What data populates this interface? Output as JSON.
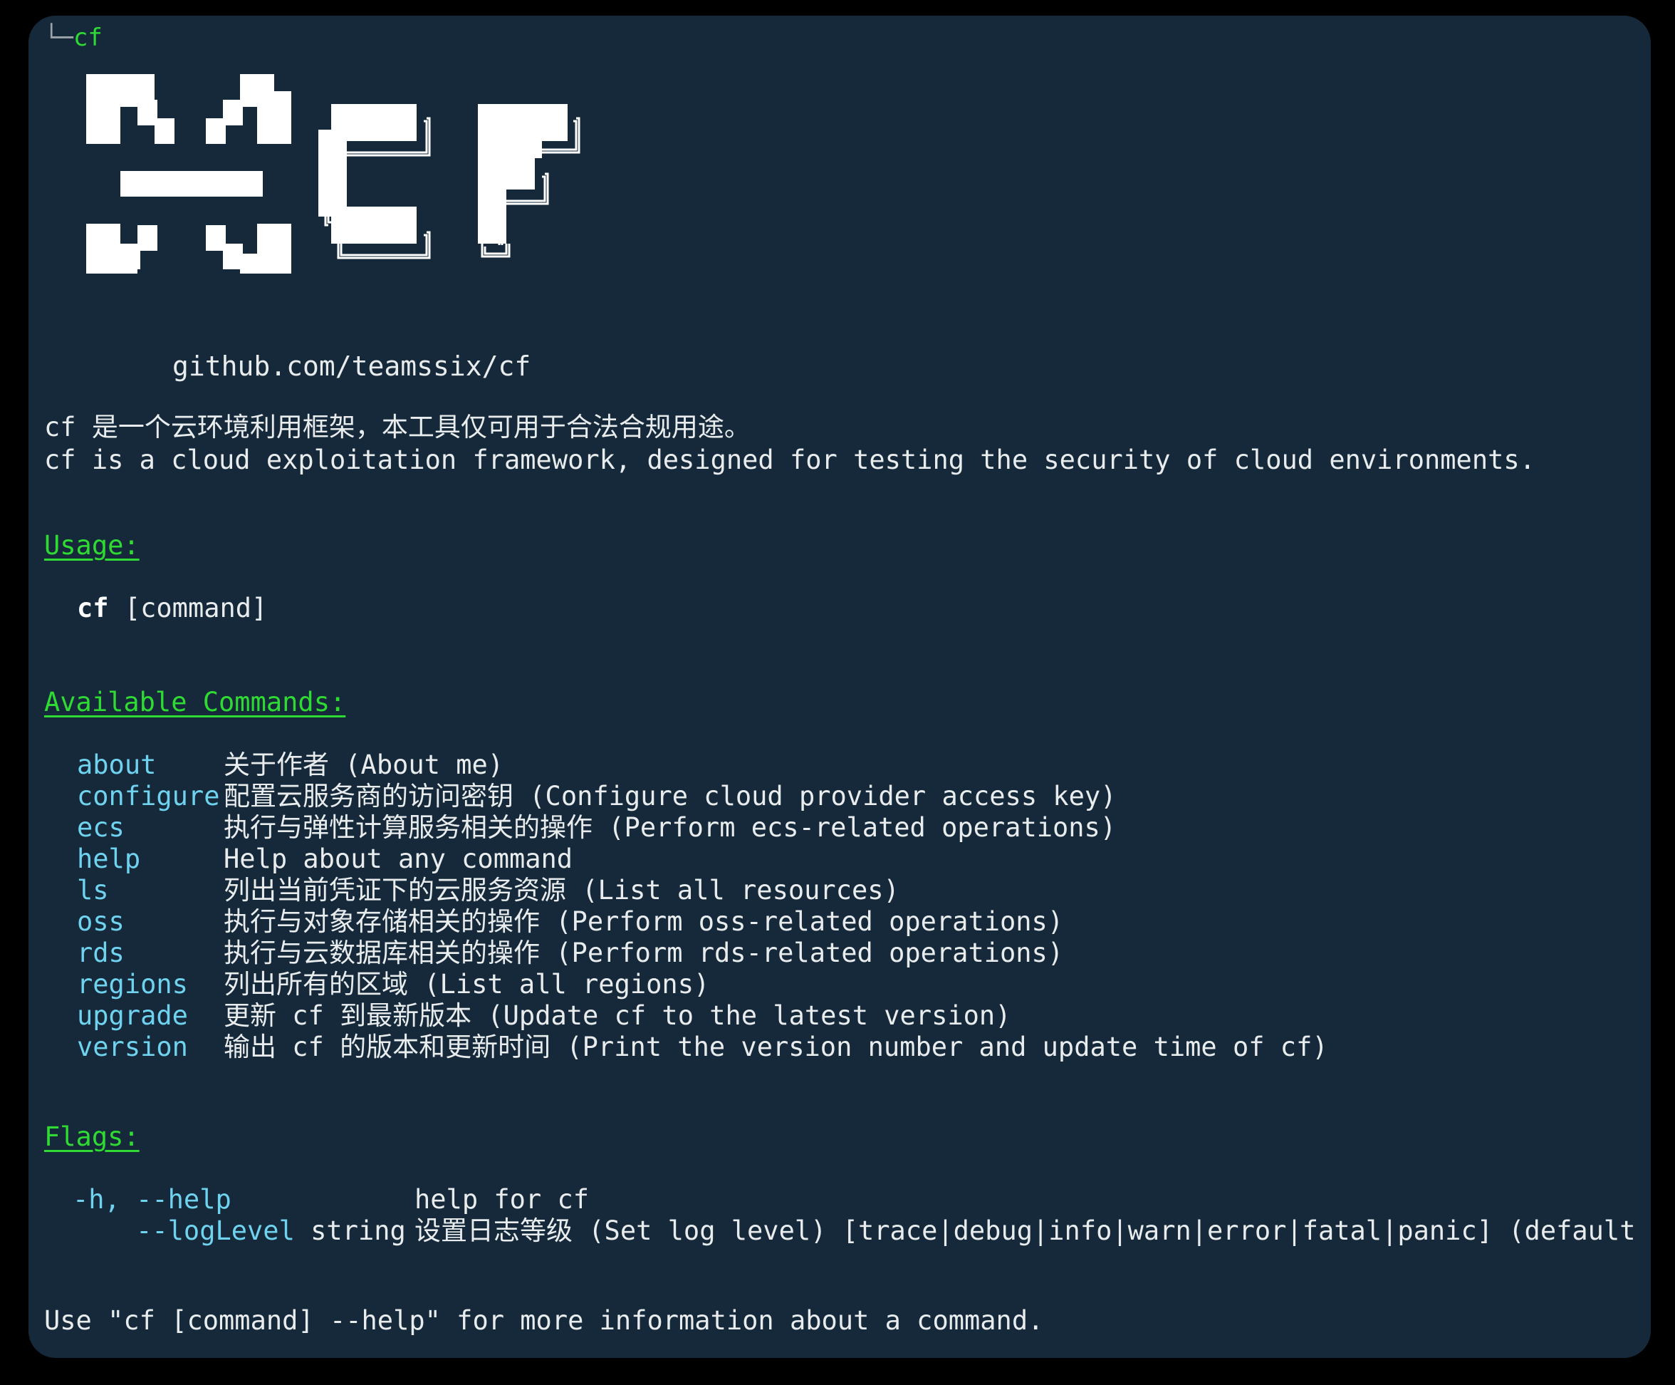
{
  "terminal": {
    "background_color": "#16293a",
    "page_background": "#000000",
    "accent_green": "#2fdb33",
    "accent_cyan": "#6fd3ef",
    "text_color": "#e8eced"
  },
  "prompt": {
    "glyph": "└─",
    "command": "cf"
  },
  "banner": {
    "icon_name": "cf-block-logo",
    "url": "github.com/teamssix/cf"
  },
  "description": {
    "line_zh": "cf 是一个云环境利用框架，本工具仅可用于合法合规用途。",
    "line_en": "cf is a cloud exploitation framework, designed for testing the security of cloud environments."
  },
  "usage": {
    "heading": "Usage:",
    "command": "cf",
    "argument": " [command]"
  },
  "available_commands": {
    "heading": "Available Commands:",
    "items": [
      {
        "name": "about",
        "description": "关于作者 (About me)"
      },
      {
        "name": "configure",
        "description": "配置云服务商的访问密钥 (Configure cloud provider access key)"
      },
      {
        "name": "ecs",
        "description": "执行与弹性计算服务相关的操作 (Perform ecs-related operations)"
      },
      {
        "name": "help",
        "description": "Help about any command"
      },
      {
        "name": "ls",
        "description": "列出当前凭证下的云服务资源 (List all resources)"
      },
      {
        "name": "oss",
        "description": "执行与对象存储相关的操作 (Perform oss-related operations)"
      },
      {
        "name": "rds",
        "description": "执行与云数据库相关的操作 (Perform rds-related operations)"
      },
      {
        "name": "regions",
        "description": "列出所有的区域 (List all regions)"
      },
      {
        "name": "upgrade",
        "description": "更新 cf 到最新版本 (Update cf to the latest version)"
      },
      {
        "name": "version",
        "description": "输出 cf 的版本和更新时间 (Print the version number and update time of cf)"
      }
    ]
  },
  "flags": {
    "heading": "Flags:",
    "items": [
      {
        "flag": "-h, --help",
        "arg": "",
        "description": "help for cf"
      },
      {
        "flag": "    --logLevel",
        "arg": " string",
        "description": "设置日志等级 (Set log level) [trace|debug|info|warn|error|fatal|panic] (default \"info\")"
      }
    ]
  },
  "footer": {
    "text": "Use \"cf [command] --help\" for more information about a command."
  }
}
